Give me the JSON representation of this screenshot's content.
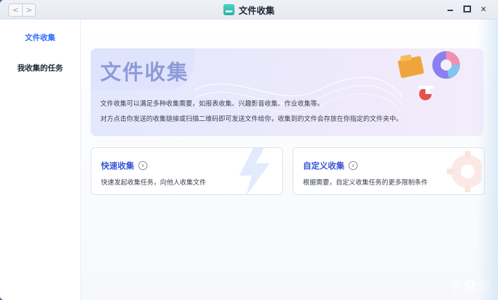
{
  "window": {
    "title": "文件收集",
    "nav_back": "<",
    "nav_forward": ">"
  },
  "sidebar": {
    "items": [
      {
        "label": "文件收集",
        "active": true
      },
      {
        "label": "我收集的任务",
        "active": false
      }
    ]
  },
  "banner": {
    "title": "文件收集",
    "desc_line1": "文件收集可以满足多种收集需要，如报表收集、兴趣影音收集、作业收集等。",
    "desc_line2": "对方点击你发送的收集链接或扫描二维码即可发送文件给你，收集到的文件会存放在你指定的文件夹中。"
  },
  "cards": [
    {
      "title": "快速收集",
      "desc": "快速发起收集任务，向他人收集文件"
    },
    {
      "title": "自定义收集",
      "desc": "根据需要，自定义收集任务的更多限制条件"
    }
  ],
  "watermark": {
    "left": "新浪",
    "right": "众测"
  },
  "colors": {
    "accent": "#2f6bff",
    "card_title": "#3a54d6",
    "banner_title": "#8e9ad8"
  },
  "icons": {
    "app": "file-collection-icon",
    "chevron": "chevron-right-circle-icon"
  }
}
